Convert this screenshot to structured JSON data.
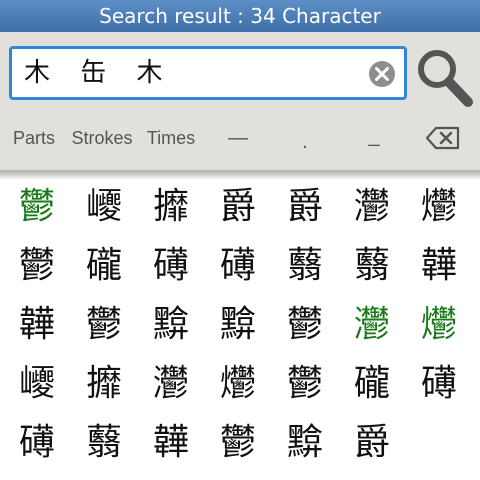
{
  "title": "Search result : 34 Character",
  "search": {
    "value": "木 缶 木",
    "clear_icon": "clear-circle-icon",
    "search_icon": "magnifier-icon"
  },
  "toolbar": {
    "parts": "Parts",
    "strokes": "Strokes",
    "times": "Times",
    "sym_dash": "—",
    "sym_dot": ".",
    "sym_underscore": "_",
    "backspace_icon": "backspace-icon"
  },
  "colors": {
    "title_bar": "#4a7bb7",
    "highlight": "#1a7a1a",
    "search_border": "#2f86d8"
  },
  "results": [
    {
      "char": "鬱",
      "highlight": true
    },
    {
      "char": "巎",
      "highlight": false
    },
    {
      "char": "攠",
      "highlight": false
    },
    {
      "char": "爵",
      "highlight": false
    },
    {
      "char": "爵",
      "highlight": false
    },
    {
      "char": "灪",
      "highlight": false
    },
    {
      "char": "爩",
      "highlight": false
    },
    {
      "char": "鬱",
      "highlight": false
    },
    {
      "char": "礲",
      "highlight": false
    },
    {
      "char": "礡",
      "highlight": false
    },
    {
      "char": "礡",
      "highlight": false
    },
    {
      "char": "蘙",
      "highlight": false
    },
    {
      "char": "蘙",
      "highlight": false
    },
    {
      "char": "韡",
      "highlight": false
    },
    {
      "char": "韡",
      "highlight": false
    },
    {
      "char": "鬱",
      "highlight": false
    },
    {
      "char": "黭",
      "highlight": false
    },
    {
      "char": "黭",
      "highlight": false
    },
    {
      "char": "鬱",
      "highlight": false
    },
    {
      "char": "灪",
      "highlight": true
    },
    {
      "char": "爩",
      "highlight": true
    },
    {
      "char": "巎",
      "highlight": false
    },
    {
      "char": "攠",
      "highlight": false
    },
    {
      "char": "灪",
      "highlight": false
    },
    {
      "char": "爩",
      "highlight": false
    },
    {
      "char": "鬱",
      "highlight": false
    },
    {
      "char": "礲",
      "highlight": false
    },
    {
      "char": "礡",
      "highlight": false
    },
    {
      "char": "礡",
      "highlight": false
    },
    {
      "char": "蘙",
      "highlight": false
    },
    {
      "char": "韡",
      "highlight": false
    },
    {
      "char": "鬱",
      "highlight": false
    },
    {
      "char": "黭",
      "highlight": false
    },
    {
      "char": "爵",
      "highlight": false
    }
  ]
}
